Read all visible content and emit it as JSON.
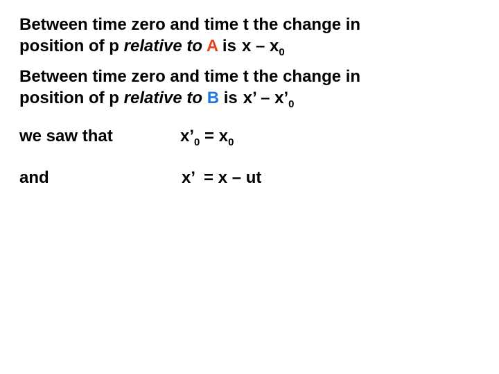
{
  "paragraphs": [
    {
      "line1": "Between time zero and time t the change in",
      "prefix": "position of p ",
      "italic": "relative to",
      "frame_label": "A",
      "frame_color": "#e8411b",
      "verb": " is",
      "expr_main": "x – x",
      "expr_sub": "0"
    },
    {
      "line1": "Between time zero and time t the change in",
      "prefix": "position of p ",
      "italic": "relative to",
      "frame_label": "B",
      "frame_color": "#1f7ae0",
      "verb": " is",
      "expr_main": "x’ – x’",
      "expr_sub": "0"
    }
  ],
  "equations": [
    {
      "label": "we saw that",
      "lhs": "x’",
      "lhs_sub": "0",
      "op": " = x",
      "rhs_sub": "0"
    },
    {
      "label": "and",
      "expr": "x’  = x – ut"
    }
  ]
}
